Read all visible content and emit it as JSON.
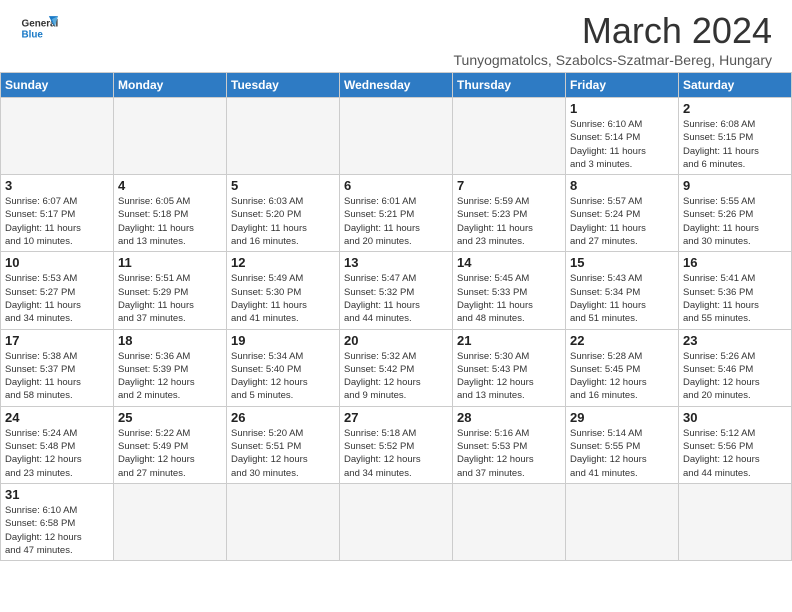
{
  "header": {
    "logo_line1": "General",
    "logo_line2": "Blue",
    "title": "March 2024",
    "subtitle": "Tunyogmatolcs, Szabolcs-Szatmar-Bereg, Hungary"
  },
  "weekdays": [
    "Sunday",
    "Monday",
    "Tuesday",
    "Wednesday",
    "Thursday",
    "Friday",
    "Saturday"
  ],
  "weeks": [
    [
      {
        "day": "",
        "info": ""
      },
      {
        "day": "",
        "info": ""
      },
      {
        "day": "",
        "info": ""
      },
      {
        "day": "",
        "info": ""
      },
      {
        "day": "",
        "info": ""
      },
      {
        "day": "1",
        "info": "Sunrise: 6:10 AM\nSunset: 5:14 PM\nDaylight: 11 hours\nand 3 minutes."
      },
      {
        "day": "2",
        "info": "Sunrise: 6:08 AM\nSunset: 5:15 PM\nDaylight: 11 hours\nand 6 minutes."
      }
    ],
    [
      {
        "day": "3",
        "info": "Sunrise: 6:07 AM\nSunset: 5:17 PM\nDaylight: 11 hours\nand 10 minutes."
      },
      {
        "day": "4",
        "info": "Sunrise: 6:05 AM\nSunset: 5:18 PM\nDaylight: 11 hours\nand 13 minutes."
      },
      {
        "day": "5",
        "info": "Sunrise: 6:03 AM\nSunset: 5:20 PM\nDaylight: 11 hours\nand 16 minutes."
      },
      {
        "day": "6",
        "info": "Sunrise: 6:01 AM\nSunset: 5:21 PM\nDaylight: 11 hours\nand 20 minutes."
      },
      {
        "day": "7",
        "info": "Sunrise: 5:59 AM\nSunset: 5:23 PM\nDaylight: 11 hours\nand 23 minutes."
      },
      {
        "day": "8",
        "info": "Sunrise: 5:57 AM\nSunset: 5:24 PM\nDaylight: 11 hours\nand 27 minutes."
      },
      {
        "day": "9",
        "info": "Sunrise: 5:55 AM\nSunset: 5:26 PM\nDaylight: 11 hours\nand 30 minutes."
      }
    ],
    [
      {
        "day": "10",
        "info": "Sunrise: 5:53 AM\nSunset: 5:27 PM\nDaylight: 11 hours\nand 34 minutes."
      },
      {
        "day": "11",
        "info": "Sunrise: 5:51 AM\nSunset: 5:29 PM\nDaylight: 11 hours\nand 37 minutes."
      },
      {
        "day": "12",
        "info": "Sunrise: 5:49 AM\nSunset: 5:30 PM\nDaylight: 11 hours\nand 41 minutes."
      },
      {
        "day": "13",
        "info": "Sunrise: 5:47 AM\nSunset: 5:32 PM\nDaylight: 11 hours\nand 44 minutes."
      },
      {
        "day": "14",
        "info": "Sunrise: 5:45 AM\nSunset: 5:33 PM\nDaylight: 11 hours\nand 48 minutes."
      },
      {
        "day": "15",
        "info": "Sunrise: 5:43 AM\nSunset: 5:34 PM\nDaylight: 11 hours\nand 51 minutes."
      },
      {
        "day": "16",
        "info": "Sunrise: 5:41 AM\nSunset: 5:36 PM\nDaylight: 11 hours\nand 55 minutes."
      }
    ],
    [
      {
        "day": "17",
        "info": "Sunrise: 5:38 AM\nSunset: 5:37 PM\nDaylight: 11 hours\nand 58 minutes."
      },
      {
        "day": "18",
        "info": "Sunrise: 5:36 AM\nSunset: 5:39 PM\nDaylight: 12 hours\nand 2 minutes."
      },
      {
        "day": "19",
        "info": "Sunrise: 5:34 AM\nSunset: 5:40 PM\nDaylight: 12 hours\nand 5 minutes."
      },
      {
        "day": "20",
        "info": "Sunrise: 5:32 AM\nSunset: 5:42 PM\nDaylight: 12 hours\nand 9 minutes."
      },
      {
        "day": "21",
        "info": "Sunrise: 5:30 AM\nSunset: 5:43 PM\nDaylight: 12 hours\nand 13 minutes."
      },
      {
        "day": "22",
        "info": "Sunrise: 5:28 AM\nSunset: 5:45 PM\nDaylight: 12 hours\nand 16 minutes."
      },
      {
        "day": "23",
        "info": "Sunrise: 5:26 AM\nSunset: 5:46 PM\nDaylight: 12 hours\nand 20 minutes."
      }
    ],
    [
      {
        "day": "24",
        "info": "Sunrise: 5:24 AM\nSunset: 5:48 PM\nDaylight: 12 hours\nand 23 minutes."
      },
      {
        "day": "25",
        "info": "Sunrise: 5:22 AM\nSunset: 5:49 PM\nDaylight: 12 hours\nand 27 minutes."
      },
      {
        "day": "26",
        "info": "Sunrise: 5:20 AM\nSunset: 5:51 PM\nDaylight: 12 hours\nand 30 minutes."
      },
      {
        "day": "27",
        "info": "Sunrise: 5:18 AM\nSunset: 5:52 PM\nDaylight: 12 hours\nand 34 minutes."
      },
      {
        "day": "28",
        "info": "Sunrise: 5:16 AM\nSunset: 5:53 PM\nDaylight: 12 hours\nand 37 minutes."
      },
      {
        "day": "29",
        "info": "Sunrise: 5:14 AM\nSunset: 5:55 PM\nDaylight: 12 hours\nand 41 minutes."
      },
      {
        "day": "30",
        "info": "Sunrise: 5:12 AM\nSunset: 5:56 PM\nDaylight: 12 hours\nand 44 minutes."
      }
    ],
    [
      {
        "day": "31",
        "info": "Sunrise: 6:10 AM\nSunset: 6:58 PM\nDaylight: 12 hours\nand 47 minutes."
      },
      {
        "day": "",
        "info": ""
      },
      {
        "day": "",
        "info": ""
      },
      {
        "day": "",
        "info": ""
      },
      {
        "day": "",
        "info": ""
      },
      {
        "day": "",
        "info": ""
      },
      {
        "day": "",
        "info": ""
      }
    ]
  ]
}
